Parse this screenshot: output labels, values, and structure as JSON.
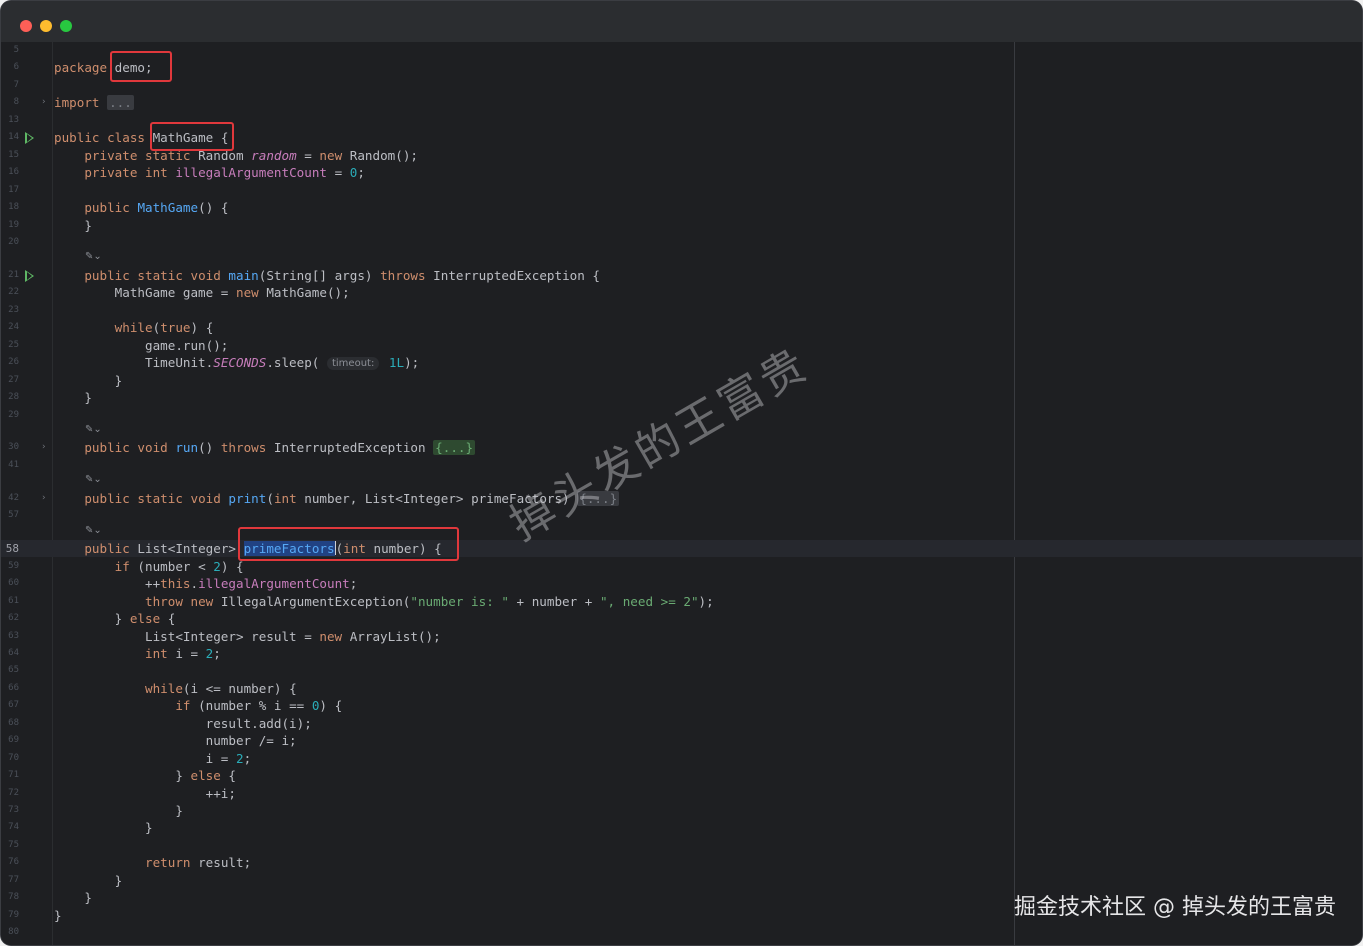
{
  "window": {
    "controls": [
      "close",
      "minimize",
      "zoom"
    ]
  },
  "editor": {
    "current_line": "58",
    "lines": [
      {
        "n": "5",
        "code": ""
      },
      {
        "n": "6",
        "code": "<span class='kw'>package</span> demo;"
      },
      {
        "n": "7",
        "code": ""
      },
      {
        "n": "8",
        "code": "<span class='kw'>import</span> <span class='fold'>...</span>",
        "fold": true
      },
      {
        "n": "13",
        "code": ""
      },
      {
        "n": "14",
        "code": "<span class='kw'>public class</span> MathGame {",
        "run": true
      },
      {
        "n": "15",
        "code": "    <span class='kw'>private static</span> Random <span class='it'>random</span> = <span class='kw'>new</span> Random();"
      },
      {
        "n": "16",
        "code": "    <span class='kw'>private int</span> <span class='field'>illegalArgumentCount</span> = <span class='num'>0</span>;"
      },
      {
        "n": "17",
        "code": ""
      },
      {
        "n": "18",
        "code": "    <span class='kw'>public</span> <span class='fn'>MathGame</span>() {"
      },
      {
        "n": "19",
        "code": "    }"
      },
      {
        "n": "20",
        "code": ""
      },
      {
        "n": "21",
        "code": "    <span class='kw'>public static void</span> <span class='fn'>main</span>(String[] args) <span class='kw'>throws</span> InterruptedException {",
        "run": true,
        "ai": true
      },
      {
        "n": "22",
        "code": "        MathGame game = <span class='kw'>new</span> MathGame();"
      },
      {
        "n": "23",
        "code": ""
      },
      {
        "n": "24",
        "code": "        <span class='kw'>while</span>(<span class='kw'>true</span>) {"
      },
      {
        "n": "25",
        "code": "            game.run();"
      },
      {
        "n": "26",
        "code": "            TimeUnit.<span class='const'>SECONDS</span>.sleep( <span class='hint'>timeout:</span> <span class='num'>1L</span>);"
      },
      {
        "n": "27",
        "code": "        }"
      },
      {
        "n": "28",
        "code": "    }"
      },
      {
        "n": "29",
        "code": ""
      },
      {
        "n": "30",
        "code": "    <span class='kw'>public void</span> <span class='fn'>run</span>() <span class='kw'>throws</span> InterruptedException <span class='fold-green'>{...}</span>",
        "fold": true,
        "ai": true
      },
      {
        "n": "41",
        "code": ""
      },
      {
        "n": "42",
        "code": "    <span class='kw'>public static void</span> <span class='fn'>print</span>(<span class='kw'>int</span> number, List&lt;Integer&gt; primeFactors) <span class='fold'>{...}</span>",
        "fold": true,
        "ai": true
      },
      {
        "n": "57",
        "code": ""
      },
      {
        "n": "58",
        "code": "    <span class='kw'>public</span> List&lt;Integer&gt; <span class='fn sel'>primeFactors</span><span class='caret'></span>(<span class='kw'>int</span> number) {",
        "ai": true
      },
      {
        "n": "59",
        "code": "        <span class='kw'>if</span> (number &lt; <span class='num'>2</span>) {"
      },
      {
        "n": "60",
        "code": "            ++<span class='kw'>this</span>.<span class='field'>illegalArgumentCount</span>;"
      },
      {
        "n": "61",
        "code": "            <span class='kw'>throw new</span> IllegalArgumentException(<span class='str'>\"number is: \"</span> + number + <span class='str'>\", need &gt;= 2\"</span>);"
      },
      {
        "n": "62",
        "code": "        } <span class='kw'>else</span> {"
      },
      {
        "n": "63",
        "code": "            List&lt;Integer&gt; result = <span class='kw'>new</span> ArrayList();"
      },
      {
        "n": "64",
        "code": "            <span class='kw'>int</span> i = <span class='num'>2</span>;"
      },
      {
        "n": "65",
        "code": ""
      },
      {
        "n": "66",
        "code": "            <span class='kw'>while</span>(i &lt;= number) {"
      },
      {
        "n": "67",
        "code": "                <span class='kw'>if</span> (number % i == <span class='num'>0</span>) {"
      },
      {
        "n": "68",
        "code": "                    result.add(i);"
      },
      {
        "n": "69",
        "code": "                    number /= i;"
      },
      {
        "n": "70",
        "code": "                    i = <span class='num'>2</span>;"
      },
      {
        "n": "71",
        "code": "                } <span class='kw'>else</span> {"
      },
      {
        "n": "72",
        "code": "                    ++i;"
      },
      {
        "n": "73",
        "code": "                }"
      },
      {
        "n": "74",
        "code": "            }"
      },
      {
        "n": "75",
        "code": ""
      },
      {
        "n": "76",
        "code": "            <span class='kw'>return</span> result;"
      },
      {
        "n": "77",
        "code": "        }"
      },
      {
        "n": "78",
        "code": "    }"
      },
      {
        "n": "79",
        "code": "}"
      },
      {
        "n": "80",
        "code": ""
      }
    ]
  },
  "watermark": "掉头发的王富贵",
  "footer_watermark": "掘金技术社区 @ 掉头发的王富贵",
  "colors": {
    "highlight_box": "#e0383c",
    "keyword": "#cf8e6d",
    "function": "#56a8f5",
    "number": "#2aacb8",
    "string": "#6aab73"
  }
}
